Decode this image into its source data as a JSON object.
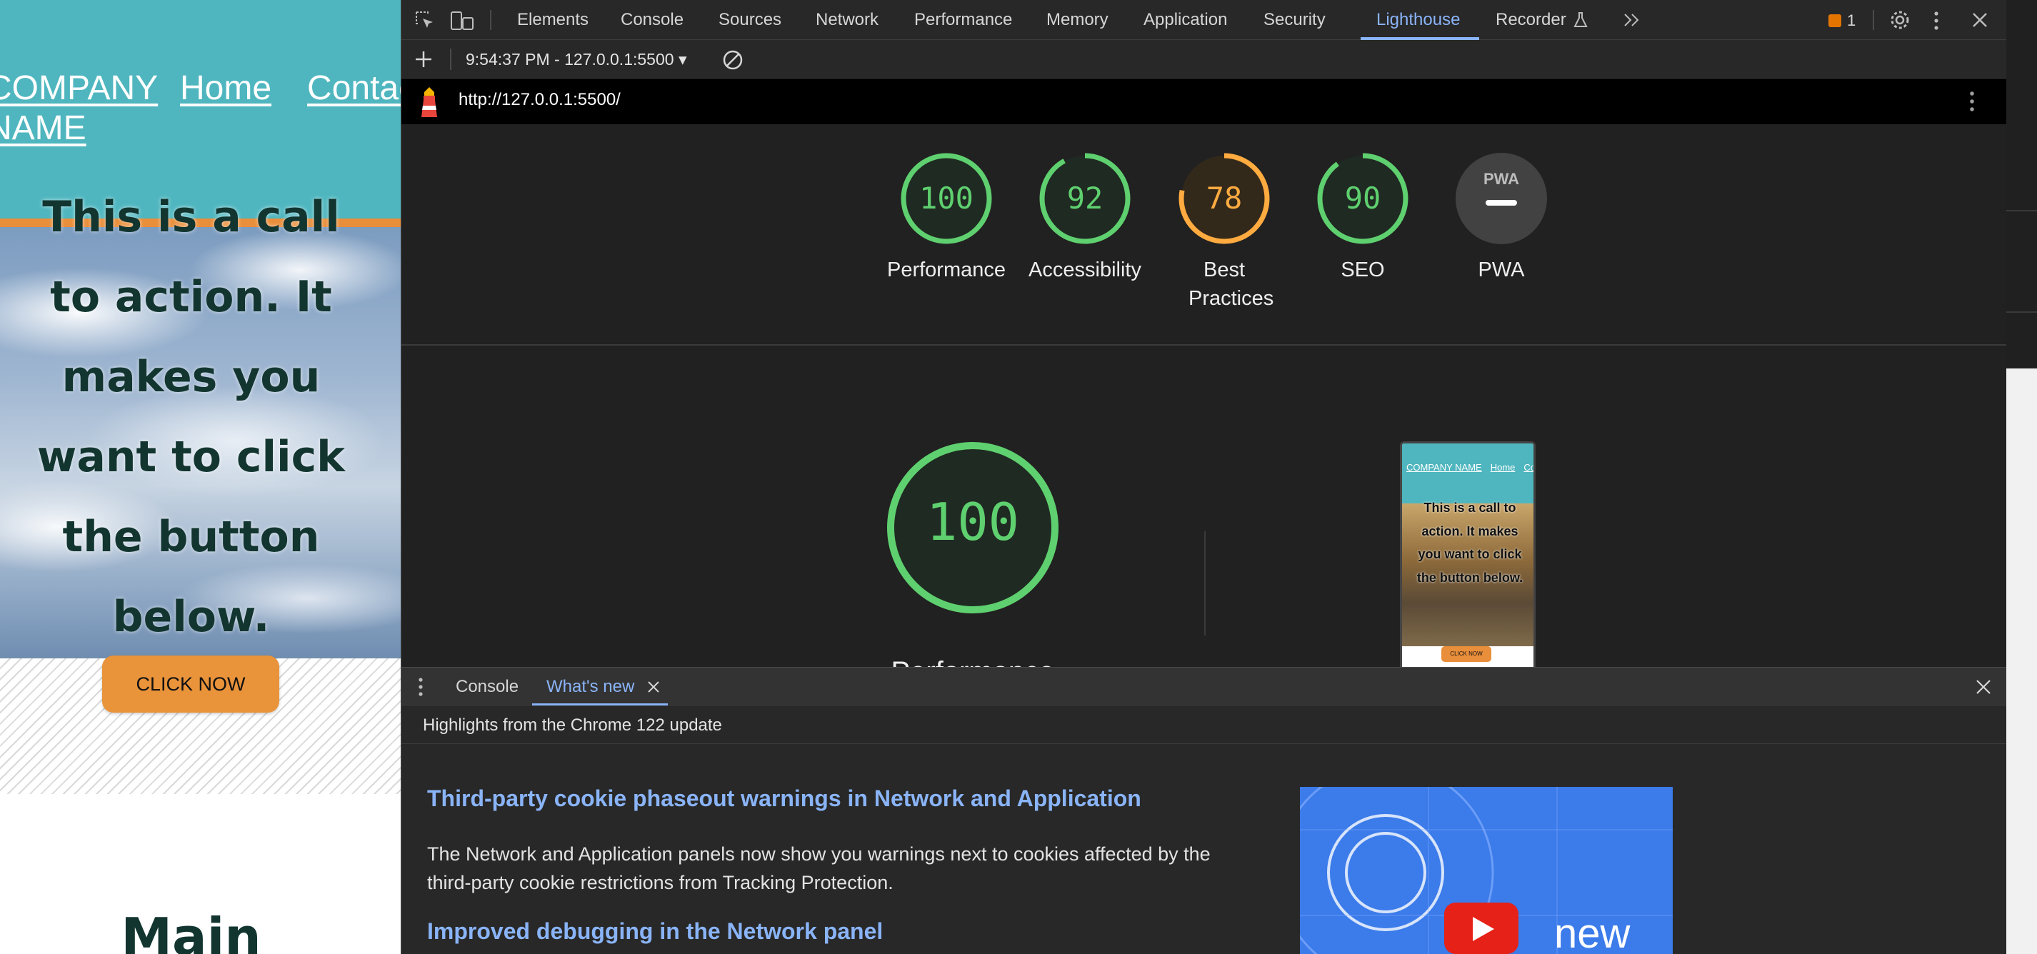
{
  "site": {
    "nav": {
      "brand": "COMPANY NAME",
      "home": "Home",
      "contact": "Contact"
    },
    "cta_text": "This is a call to action. It makes you want to click the button below.",
    "cta_button": "CLICK NOW",
    "main_heading": "Main"
  },
  "devtools": {
    "tabs": [
      "Elements",
      "Console",
      "Sources",
      "Network",
      "Performance",
      "Memory",
      "Application",
      "Security",
      "Lighthouse",
      "Recorder"
    ],
    "active_tab": "Lighthouse",
    "issues_count": "1",
    "report_select": "9:54:37 PM - 127.0.0.1:5500",
    "url": "http://127.0.0.1:5500/",
    "categories": [
      {
        "label": "Performance",
        "score": "100",
        "value": 100,
        "color": "#0cce6b"
      },
      {
        "label": "Accessibility",
        "score": "92",
        "value": 92,
        "color": "#0cce6b"
      },
      {
        "label": "Best Practices",
        "score": "78",
        "value": 78,
        "color": "#ffa400"
      },
      {
        "label": "SEO",
        "score": "90",
        "value": 90,
        "color": "#0cce6b"
      },
      {
        "label": "PWA",
        "score": "PWA",
        "value": null,
        "color": "#9e9e9e"
      }
    ],
    "big_gauge": {
      "label": "Performance",
      "score": "100",
      "value": 100
    },
    "phone_preview": {
      "brand": "COMPANY NAME",
      "home": "Home",
      "contact": "Contac",
      "cta": "This is a call to action. It makes you want to click the button below.",
      "button": "CLICK NOW"
    },
    "drawer": {
      "tabs": [
        "Console",
        "What's new"
      ],
      "active_tab": "What's new",
      "subtitle": "Highlights from the Chrome 122 update",
      "items": [
        {
          "title": "Third-party cookie phaseout warnings in Network and Application",
          "body": "The Network and Application panels now show you warnings next to cookies affected by the third-party cookie restrictions from Tracking Protection."
        },
        {
          "title": "Improved debugging in the Network panel"
        }
      ],
      "video_label": "new"
    }
  },
  "colors": {
    "accent": "#8ab4f8",
    "pass": "#0cce6b",
    "average": "#ffa400",
    "site_teal": "#4fb6bf",
    "site_orange": "#e98e3a"
  }
}
